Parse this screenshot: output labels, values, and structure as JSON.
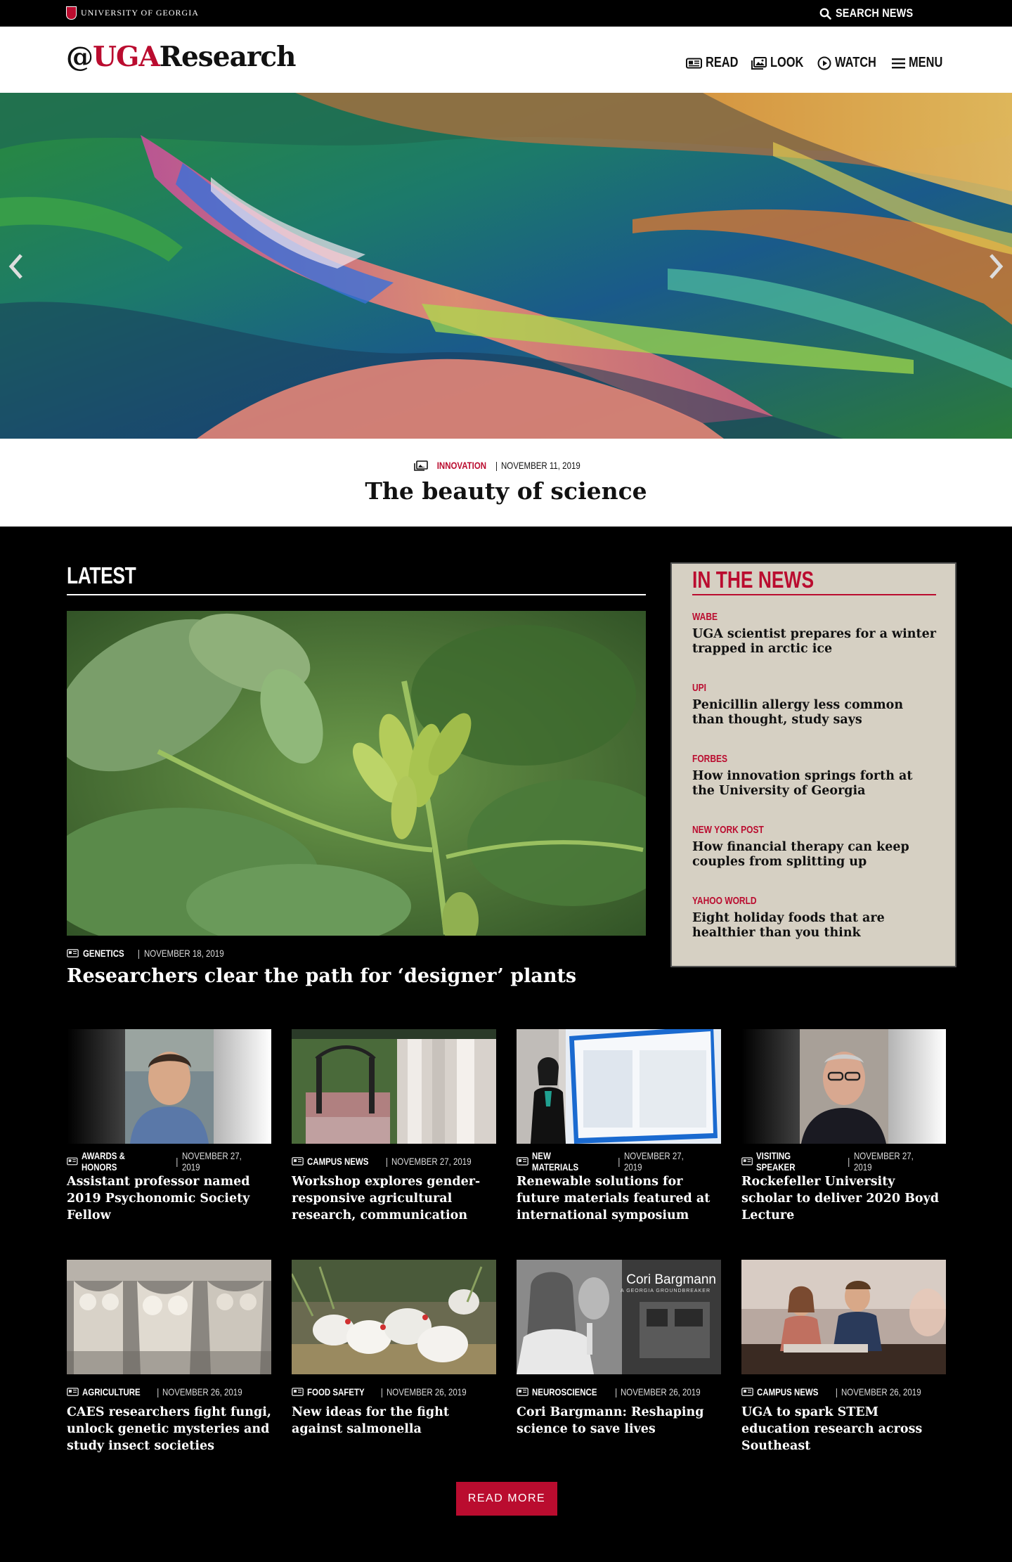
{
  "utility": {
    "brand": "UNIVERSITY OF GEORGIA",
    "search_label": "SEARCH NEWS"
  },
  "header": {
    "logo_prefix": "@",
    "logo_red": "UGA",
    "logo_suffix": "Research",
    "nav": [
      {
        "label": "READ",
        "icon": "newspaper-icon"
      },
      {
        "label": "LOOK",
        "icon": "image-icon"
      },
      {
        "label": "WATCH",
        "icon": "play-circle-icon"
      },
      {
        "label": "MENU",
        "icon": "hamburger-icon"
      }
    ]
  },
  "hero": {
    "category": "INNOVATION",
    "date": "NOVEMBER 11, 2019",
    "title": "The beauty of science"
  },
  "latest": {
    "heading": "LATEST",
    "feature": {
      "category": "GENETICS",
      "date": "NOVEMBER 18, 2019",
      "title": "Researchers clear the path for ‘designer’ plants"
    }
  },
  "in_the_news": {
    "heading": "IN THE NEWS",
    "items": [
      {
        "source": "WABE",
        "title": "UGA scientist prepares for a winter trapped in arctic ice"
      },
      {
        "source": "UPI",
        "title": "Penicillin allergy less common than thought, study says"
      },
      {
        "source": "FORBES",
        "title": "How innovation springs forth at the University of Georgia"
      },
      {
        "source": "NEW YORK POST",
        "title": "How financial therapy can keep couples from splitting up"
      },
      {
        "source": "YAHOO WORLD",
        "title": "Eight holiday foods that are healthier than you think"
      }
    ]
  },
  "cards": [
    {
      "category": "AWARDS & HONORS",
      "date": "NOVEMBER 27, 2019",
      "title": "Assistant professor named 2019 Psychonomic Society Fellow"
    },
    {
      "category": "CAMPUS NEWS",
      "date": "NOVEMBER 27, 2019",
      "title": "Workshop explores gender-responsive agricultural research, communication"
    },
    {
      "category": "NEW MATERIALS",
      "date": "NOVEMBER 27, 2019",
      "title": "Renewable solutions for future materials featured at international symposium"
    },
    {
      "category": "VISITING SPEAKER",
      "date": "NOVEMBER 27, 2019",
      "title": "Rockefeller University scholar to deliver 2020 Boyd Lecture"
    },
    {
      "category": "AGRICULTURE",
      "date": "NOVEMBER 26, 2019",
      "title": "CAES researchers fight fungi, unlock genetic mysteries and study insect societies"
    },
    {
      "category": "FOOD SAFETY",
      "date": "NOVEMBER 26, 2019",
      "title": "New ideas for the fight against salmonella"
    },
    {
      "category": "NEUROSCIENCE",
      "date": "NOVEMBER 26, 2019",
      "title": "Cori Bargmann: Reshaping science to save lives"
    },
    {
      "category": "CAMPUS NEWS",
      "date": "NOVEMBER 26, 2019",
      "title": "UGA to spark STEM education research across Southeast"
    }
  ],
  "card_image_text": {
    "name": "Cori Bargmann",
    "tagline": "A GEORGIA GROUNDBREAKER"
  },
  "read_more": "READ MORE",
  "colors": {
    "accent": "#ba0c2f",
    "panel": "#d6d0c3",
    "background": "#000000"
  }
}
